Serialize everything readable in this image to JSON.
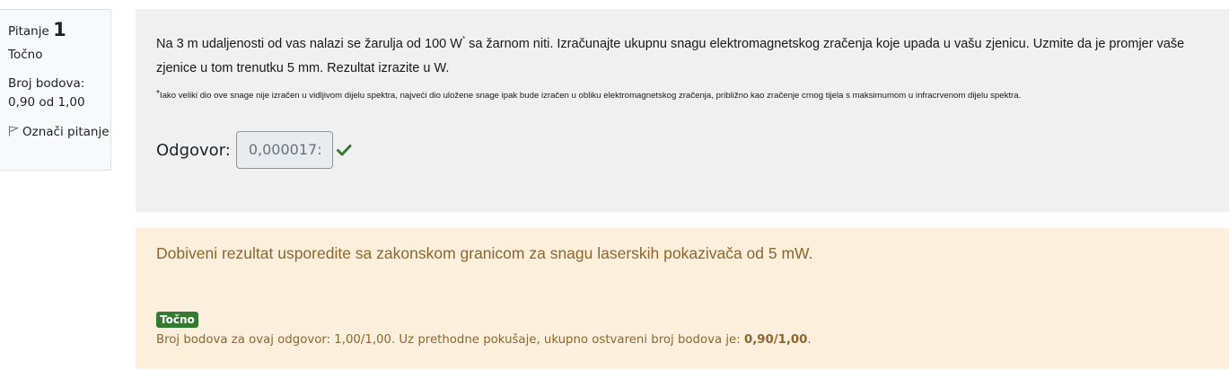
{
  "info": {
    "question_label": "Pitanje",
    "question_number": "1",
    "state": "Točno",
    "grade_label": "Broj bodova:",
    "grade_value": "0,90 od 1,00",
    "flag_label": "Označi pitanje"
  },
  "question": {
    "text_part1": "Na 3 m udaljenosti od vas nalazi se žarulja od 100 W",
    "text_sup": "*",
    "text_part2": " sa žarnom niti. Izračunajte ukupnu snagu elektromagnetskog zračenja koje upada u vašu zjenicu. Uzmite da je promjer vaše zjenice u tom trenutku 5 mm. Rezultat izrazite u W.",
    "footnote_sup": "*",
    "footnote": "Iako veliki dio ove snage nije izračen u vidljivom dijelu spektra, najveći dio uložene snage ipak bude izračen u obliku elektromagnetskog zračenja, približno kao zračenje crnog tijela s maksimumom u infracrvenom dijelu spektra.",
    "answer_label": "Odgovor:",
    "answer_value": "0,000017:"
  },
  "outcome": {
    "feedback": "Dobiveni rezultat usporedite sa zakonskom granicom za snagu laserskih pokazivača od 5 mW.",
    "badge": "Točno",
    "grade_text": "Broj bodova za ovaj odgovor: 1,00/1,00. Uz prethodne pokušaje, ukupno ostvareni broj bodova je: ",
    "grade_total": "0,90/1,00",
    "grade_end": "."
  },
  "colors": {
    "correct_green": "#357a32",
    "outcome_bg": "#fcefdc",
    "outcome_text": "#8e662e"
  }
}
